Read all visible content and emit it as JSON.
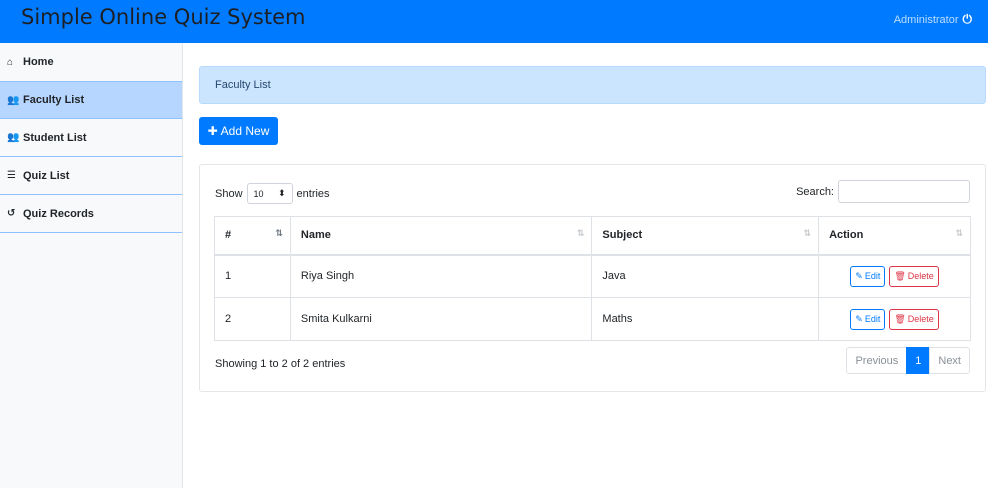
{
  "header": {
    "title": "Simple Online Quiz System",
    "user": "Administrator",
    "power_icon": "⏻"
  },
  "sidebar": {
    "items": [
      {
        "label": "Home",
        "icon": "home-icon",
        "glyph": "⌂"
      },
      {
        "label": "Faculty List",
        "icon": "users-icon",
        "glyph": "👥"
      },
      {
        "label": "Student List",
        "icon": "users-icon",
        "glyph": "👥"
      },
      {
        "label": "Quiz List",
        "icon": "list-icon",
        "glyph": "☰"
      },
      {
        "label": "Quiz Records",
        "icon": "history-icon",
        "glyph": "↺"
      }
    ],
    "active_index": 1
  },
  "breadcrumb": "Faculty List",
  "add_button": "Add New",
  "table_controls": {
    "show": "Show",
    "length_value": "10",
    "entries": "entries",
    "search_label": "Search:"
  },
  "table": {
    "columns": [
      "#",
      "Name",
      "Subject",
      "Action"
    ],
    "rows": [
      {
        "num": "1",
        "name": "Riya Singh",
        "subject": "Java"
      },
      {
        "num": "2",
        "name": "Smita Kulkarni",
        "subject": "Maths"
      }
    ],
    "edit_label": "Edit",
    "delete_label": "Delete"
  },
  "footer": {
    "info": "Showing 1 to 2 of 2 entries",
    "previous": "Previous",
    "page": "1",
    "next": "Next"
  },
  "colors": {
    "primary": "#007bff",
    "danger": "#dc3545",
    "breadcrumb_bg": "#cce5ff",
    "sidebar_active": "#b7d6ff"
  }
}
